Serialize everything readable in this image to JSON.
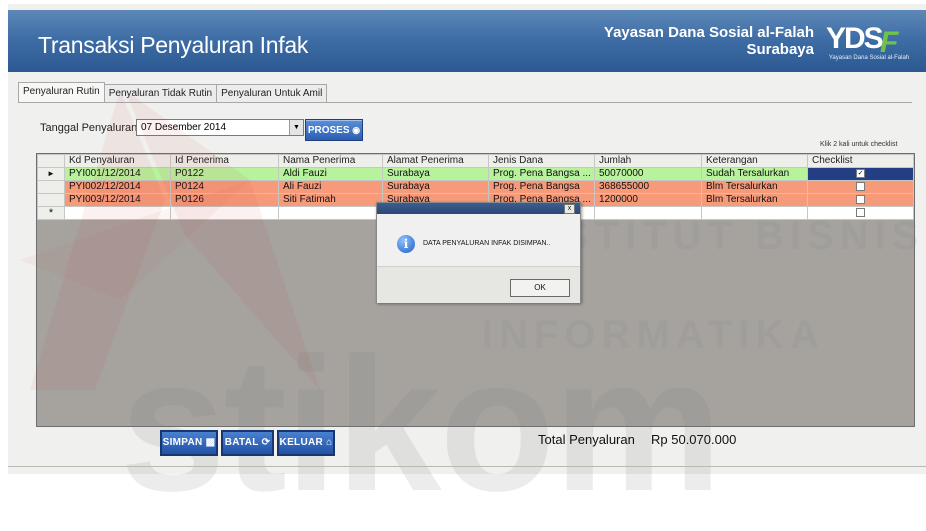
{
  "header": {
    "title": "Transaksi Penyaluran Infak",
    "org_line1": "Yayasan Dana Sosial al-Falah",
    "org_line2": "Surabaya",
    "logo_text": "YDSF",
    "logo_subtext": "Yayasan Dana Sosial al-Falah"
  },
  "tabs": [
    {
      "label": "Penyaluran Rutin",
      "active": true
    },
    {
      "label": "Penyaluran Tidak Rutin",
      "active": false
    },
    {
      "label": "Penyaluran Untuk Amil",
      "active": false
    }
  ],
  "form": {
    "tanggal_label": "Tanggal Penyaluran",
    "tanggal_value": "07 Desember 2014",
    "proses_label": "PROSES",
    "note": "Klik 2 kali untuk checklist"
  },
  "grid": {
    "columns": [
      "Kd Penyaluran",
      "Id Penerima",
      "Nama Penerima",
      "Alamat Penerima",
      "Jenis Dana",
      "Jumlah",
      "Keterangan",
      "Checklist"
    ],
    "rows": [
      {
        "kd": "PYI001/12/2014",
        "id": "P0122",
        "nama": "Aldi Fauzi",
        "alamat": "Surabaya",
        "jenis": "Prog. Pena Bangsa ...",
        "jumlah": "50070000",
        "ket": "Sudah Tersalurkan",
        "checked": true,
        "status": "green",
        "current": true
      },
      {
        "kd": "PYI002/12/2014",
        "id": "P0124",
        "nama": "Ali Fauzi",
        "alamat": "Surabaya",
        "jenis": "Prog. Pena Bangsa",
        "jumlah": "368655000",
        "ket": "Blm Tersalurkan",
        "checked": false,
        "status": "salmon",
        "current": false
      },
      {
        "kd": "PYI003/12/2014",
        "id": "P0126",
        "nama": "Siti Fatimah",
        "alamat": "Surabaya",
        "jenis": "Prog. Pena Bangsa ...",
        "jumlah": "1200000",
        "ket": "Blm Tersalurkan",
        "checked": false,
        "status": "salmon",
        "current": false
      }
    ],
    "new_row_marker": "*"
  },
  "dialog": {
    "message": "DATA PENYALURAN INFAK DISIMPAN..",
    "ok_label": "OK",
    "close_glyph": "x"
  },
  "buttons": {
    "simpan": "SIMPAN",
    "batal": "BATAL",
    "keluar": "KELUAR"
  },
  "total": {
    "label": "Total Penyaluran",
    "value": "Rp 50.070.000"
  },
  "watermark": {
    "line1": "INSTITUT BISNIS",
    "line2": "DAN INFORMATIKA",
    "word": "stikom"
  },
  "colors": {
    "header_blue": "#3f6ea6",
    "row_green": "#b7f39c",
    "row_salmon": "#f79a7a",
    "grid_bg": "#a6a39f",
    "button_blue": "#2c5eb2"
  }
}
